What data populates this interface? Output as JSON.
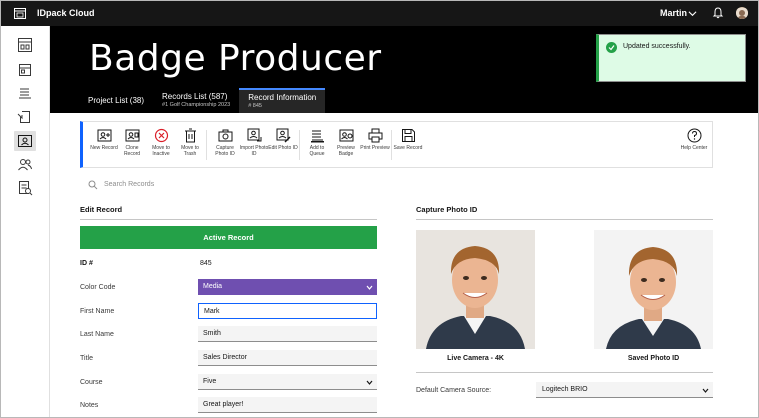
{
  "app": {
    "title": "IDpack Cloud",
    "user": "Martin"
  },
  "page": {
    "title": "Badge Producer"
  },
  "tabs": [
    {
      "label": "Project List (38)",
      "sub": ""
    },
    {
      "label": "Records List (587)",
      "sub": "#1 Golf Championship 2023"
    },
    {
      "label": "Record Information",
      "sub": "# 845"
    }
  ],
  "toast": {
    "message": "Updated successfully."
  },
  "toolbar": {
    "new": "New Record",
    "clone": "Clone Record",
    "move_inactive": "Move to Inactive",
    "move_trash": "Move to Trash",
    "capture": "Capture Photo ID",
    "import": "Import Photo ID",
    "edit": "Edit Photo ID",
    "queue": "Add to Queue",
    "preview": "Preview Badge",
    "print": "Print Preview",
    "save": "Save Record",
    "help": "Help Center"
  },
  "search": {
    "placeholder": "Search Records"
  },
  "edit": {
    "title": "Edit Record",
    "status": "Active Record",
    "id_label": "ID #",
    "id_value": "845",
    "fields": [
      {
        "label": "Color Code",
        "value": "Media"
      },
      {
        "label": "First Name",
        "value": "Mark"
      },
      {
        "label": "Last Name",
        "value": "Smith"
      },
      {
        "label": "Title",
        "value": "Sales Director"
      },
      {
        "label": "Course",
        "value": "Five"
      },
      {
        "label": "Notes",
        "value": "Great player!"
      }
    ]
  },
  "capture": {
    "title": "Capture Photo ID",
    "live_caption": "Live Camera - 4K",
    "saved_caption": "Saved Photo ID",
    "camera_label": "Default Camera Source:",
    "camera_value": "Logitech BRIO"
  },
  "colors": {
    "accent": "#0f62fe",
    "success": "#24a148",
    "purple": "#6f4fb0",
    "header": "#000000"
  }
}
